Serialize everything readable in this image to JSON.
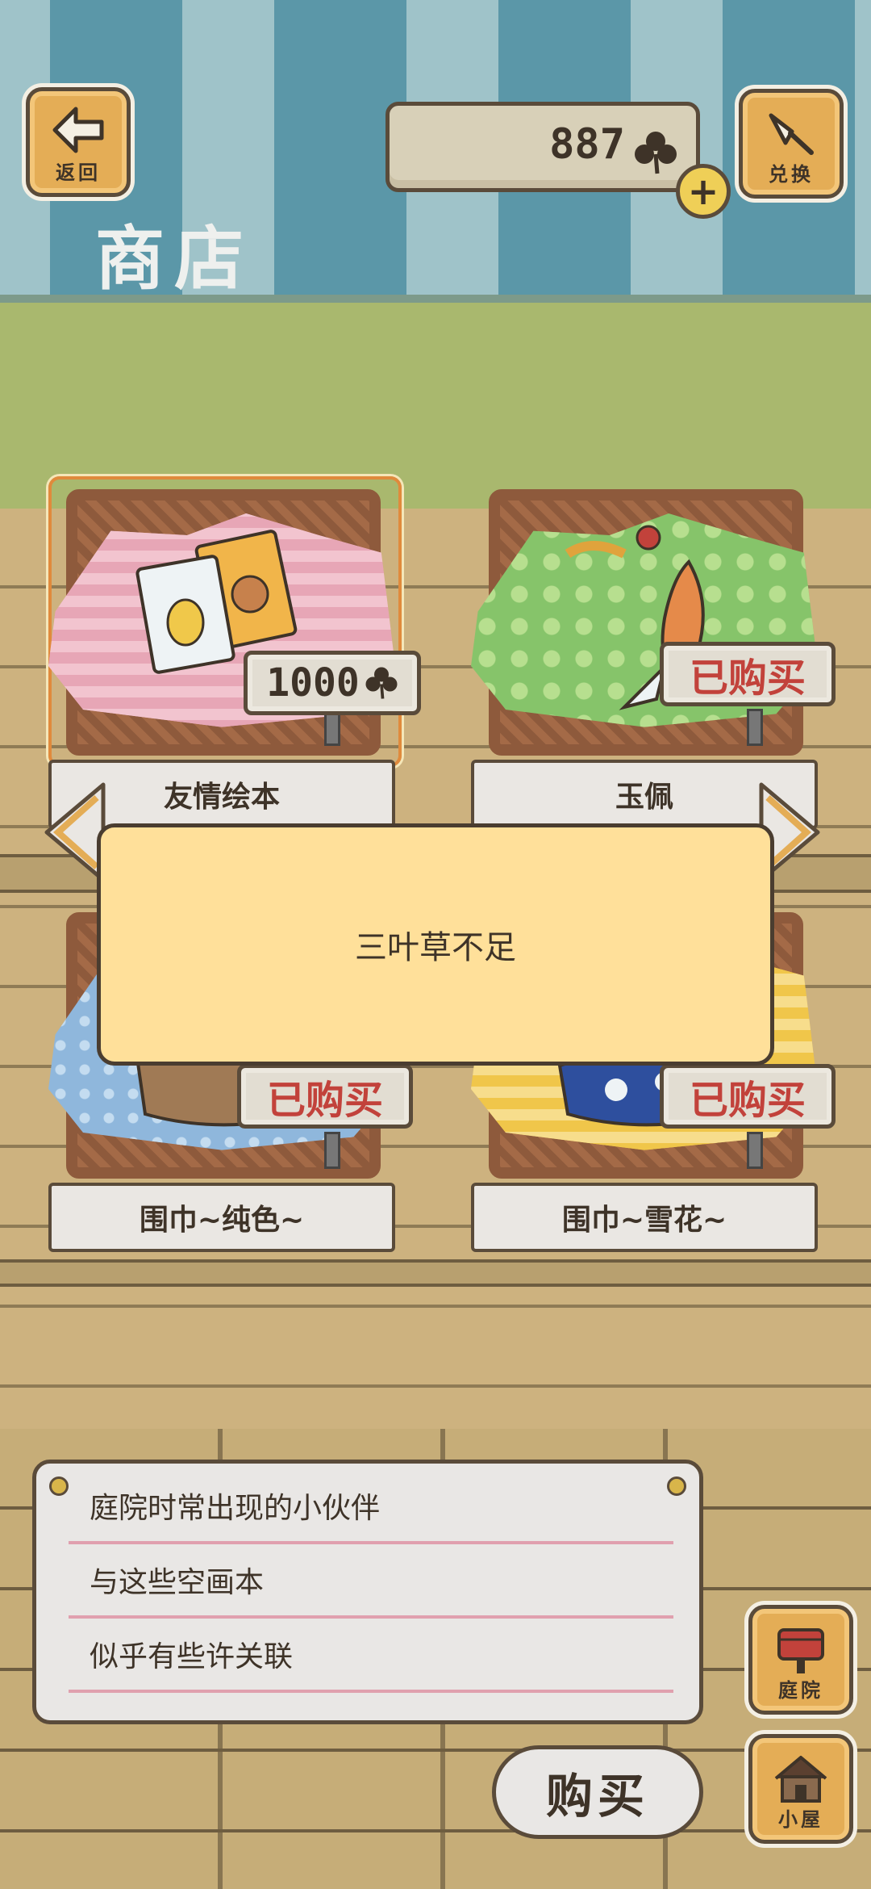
{
  "header": {
    "back_label": "返回",
    "title": "商店",
    "clover_count": "887",
    "plus_symbol": "+",
    "exchange_label": "兑换"
  },
  "items": [
    {
      "name": "友情绘本",
      "price": "1000",
      "status": "price",
      "cloth_color": "#e7a6b6"
    },
    {
      "name": "玉佩",
      "status_label": "已购买",
      "status": "bought",
      "cloth_color": "#86c46a"
    },
    {
      "name": "围巾~纯色~",
      "status_label": "已购买",
      "status": "bought",
      "cloth_color": "#8fb7dc"
    },
    {
      "name": "围巾~雪花~",
      "status_label": "已购买",
      "status": "bought",
      "cloth_color": "#f0c64a"
    }
  ],
  "modal": {
    "message": "三叶草不足"
  },
  "description": {
    "lines": [
      "庭院时常出现的小伙伴",
      "与这些空画本",
      "似乎有些许关联"
    ]
  },
  "buy_label": "购买",
  "nav": {
    "yard_label": "庭院",
    "house_label": "小屋"
  },
  "icons": {
    "back": "left-arrow-icon",
    "exchange": "bell-icon",
    "clover": "clover-icon",
    "yard": "mailbox-icon",
    "house": "house-icon"
  },
  "colors": {
    "accent_red": "#c2423b",
    "modal_bg": "#ffe09a",
    "wood": "#e4ad56"
  }
}
